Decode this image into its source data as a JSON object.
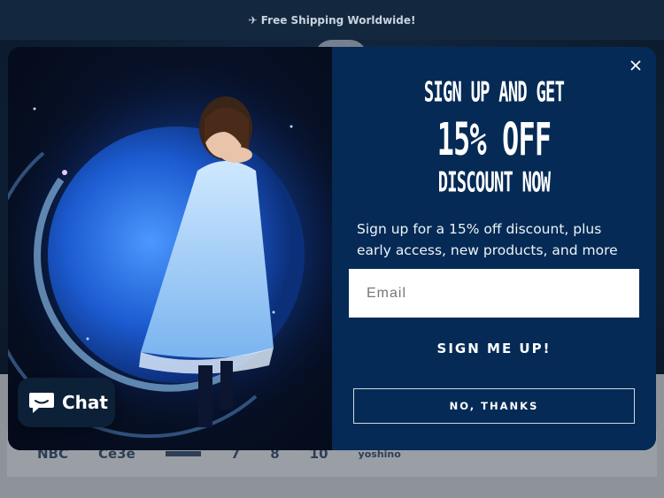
{
  "announcement": {
    "text": "✈ Free Shipping Worldwide!"
  },
  "press": {
    "logos": [
      "NBC",
      "Ce3e",
      "",
      "7",
      "8",
      "10",
      "yoshino"
    ]
  },
  "modal": {
    "headline_1": "SIGN UP AND GET",
    "headline_2": "15% OFF",
    "headline_3": "DISCOUNT NOW",
    "description": "Sign up for a 15% off discount, plus early access, new products, and more",
    "email_placeholder": "Email",
    "email_value": "",
    "signup_label": "SIGN ME UP!",
    "decline_label": "NO, THANKS"
  },
  "chat": {
    "label": "Chat",
    "icon": "chat-bubble-icon"
  },
  "colors": {
    "panel": "#042a55",
    "announce_bg": "#13283e",
    "accent_text": "#ffffff"
  }
}
